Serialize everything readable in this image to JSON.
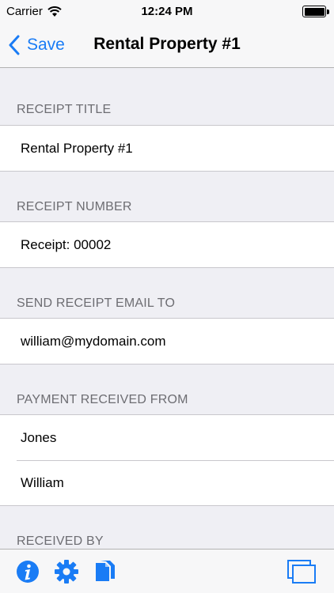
{
  "status_bar": {
    "carrier": "Carrier",
    "time": "12:24 PM",
    "battery_level": 1.0
  },
  "nav": {
    "back_label": "Save",
    "title": "Rental Property #1"
  },
  "sections": {
    "receipt_title": {
      "header": "RECEIPT TITLE",
      "value": "Rental Property #1"
    },
    "receipt_number": {
      "header": "RECEIPT NUMBER",
      "value": "Receipt: 00002"
    },
    "email": {
      "header": "SEND RECEIPT EMAIL TO",
      "value": "william@mydomain.com"
    },
    "payment_from": {
      "header": "PAYMENT RECEIVED FROM",
      "last_name": "Jones",
      "first_name": "William"
    },
    "received_by": {
      "header": "RECEIVED BY"
    }
  },
  "toolbar": {
    "icons": [
      "info-icon",
      "gear-icon",
      "documents-icon",
      "windows-icon"
    ]
  },
  "colors": {
    "accent": "#1a7cf5",
    "background": "#efeff4",
    "header_text": "#6d6d72"
  }
}
